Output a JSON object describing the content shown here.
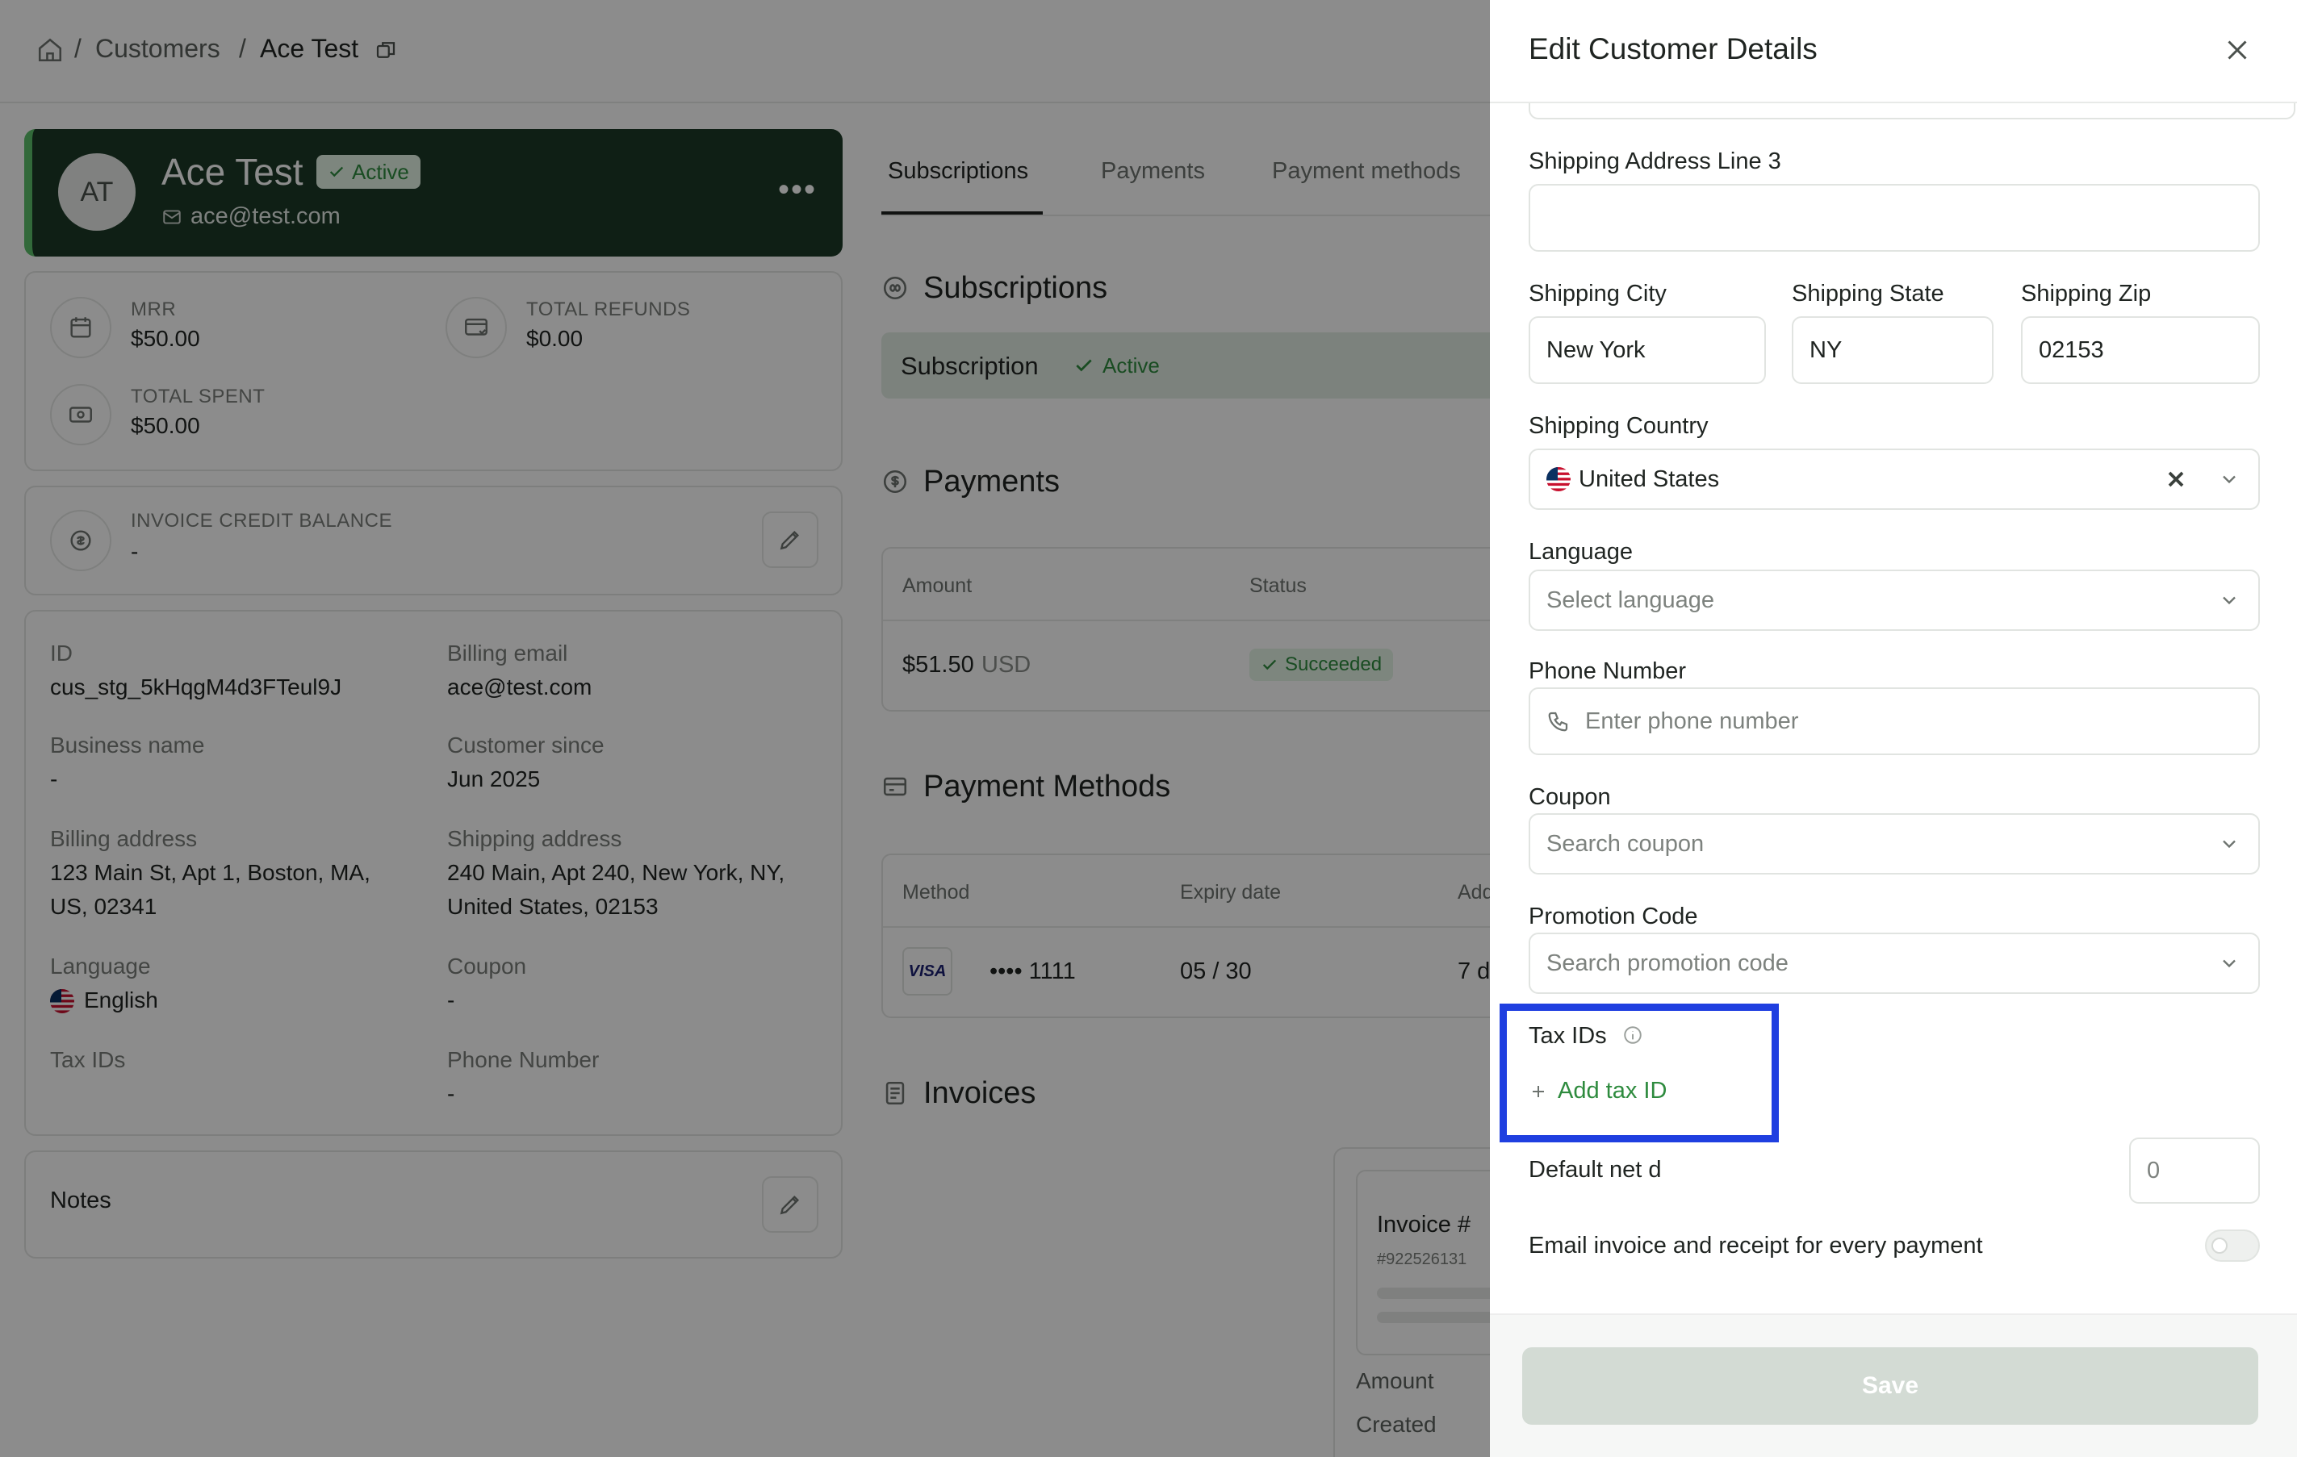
{
  "breadcrumb": {
    "customers": "Customers",
    "current": "Ace Test"
  },
  "profile": {
    "initials": "AT",
    "name": "Ace Test",
    "status": "Active",
    "email": "ace@test.com"
  },
  "stats": {
    "mrr_label": "MRR",
    "mrr_value": "$50.00",
    "refunds_label": "TOTAL REFUNDS",
    "refunds_value": "$0.00",
    "spent_label": "TOTAL SPENT",
    "spent_value": "$50.00"
  },
  "credit": {
    "label": "INVOICE CREDIT BALANCE",
    "value": "-"
  },
  "details": {
    "id_label": "ID",
    "id_value": "cus_stg_5kHqgM4d3FTeul9J",
    "billing_email_label": "Billing email",
    "billing_email_value": "ace@test.com",
    "business_label": "Business name",
    "business_value": "-",
    "since_label": "Customer since",
    "since_value": "Jun 2025",
    "billing_addr_label": "Billing address",
    "billing_addr_l1": "123 Main St, Apt 1, Boston, MA,",
    "billing_addr_l2": "US, 02341",
    "shipping_addr_label": "Shipping address",
    "shipping_addr_l1": "240 Main, Apt 240, New York, NY,",
    "shipping_addr_l2": "United States, 02153",
    "language_label": "Language",
    "language_value": "English",
    "coupon_label": "Coupon",
    "coupon_value": "-",
    "taxids_label": "Tax IDs",
    "phone_label": "Phone Number",
    "phone_value": "-"
  },
  "notes": {
    "label": "Notes"
  },
  "tabs": [
    "Subscriptions",
    "Payments",
    "Payment methods"
  ],
  "subscriptions": {
    "title": "Subscriptions",
    "row_label": "Subscription",
    "row_status": "Active"
  },
  "payments": {
    "title": "Payments",
    "col_amount": "Amount",
    "col_status": "Status",
    "amount": "$51.50",
    "currency": "USD",
    "status": "Succeeded"
  },
  "payment_methods": {
    "title": "Payment Methods",
    "col_method": "Method",
    "col_expiry": "Expiry date",
    "col_added": "Add",
    "brand": "VISA",
    "last4": "•••• 1111",
    "expiry": "05 / 30",
    "added": "7 d"
  },
  "invoices": {
    "title": "Invoices",
    "card_title": "Invoice #",
    "card_number": "#922526131",
    "amount_label": "Amount",
    "created_label": "Created"
  },
  "drawer": {
    "title": "Edit Customer Details",
    "addr3_label": "Shipping Address Line 3",
    "addr3_value": "",
    "city_label": "Shipping City",
    "city_value": "New York",
    "state_label": "Shipping State",
    "state_value": "NY",
    "zip_label": "Shipping Zip",
    "zip_value": "02153",
    "country_label": "Shipping Country",
    "country_value": "United States",
    "language_label": "Language",
    "language_placeholder": "Select language",
    "phone_label": "Phone Number",
    "phone_placeholder": "Enter phone number",
    "coupon_label": "Coupon",
    "coupon_placeholder": "Search coupon",
    "promo_label": "Promotion Code",
    "promo_placeholder": "Search promotion code",
    "taxids_label": "Tax IDs",
    "add_taxid": "Add tax ID",
    "net_label": "Default net d",
    "net_placeholder": "0",
    "email_toggle_label": "Email invoice and receipt for every payment",
    "save_label": "Save"
  },
  "colors": {
    "brand_dark": "#1c3a27",
    "accent_green": "#2e8b3e",
    "highlight": "#1f3fe0",
    "overlay": "rgba(0,0,0,0.45)"
  }
}
